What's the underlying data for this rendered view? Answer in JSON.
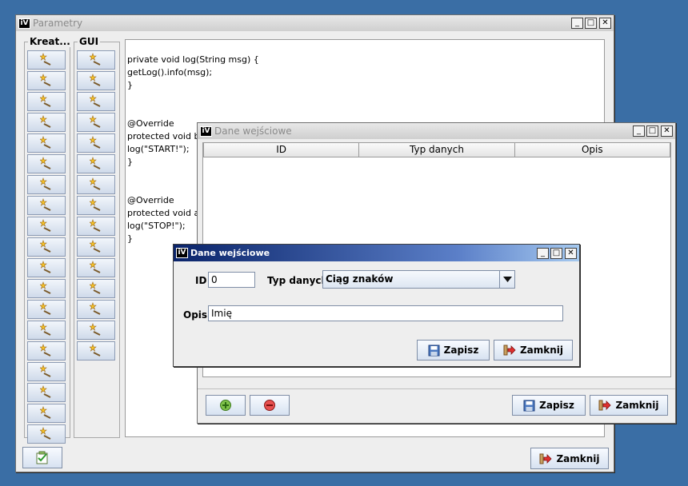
{
  "main_window": {
    "icon_text": "iV",
    "title": "Parametry",
    "controls": {
      "minimize": "_",
      "maximize": "□",
      "close": "✕"
    },
    "col_kreator_label": "Kreat...",
    "col_gui_label": "GUI",
    "code_lines": [
      "private void log(String msg) {",
      "getLog().info(msg);",
      "}",
      "",
      "",
      "@Override",
      "protected void be",
      "log(\"START!\");",
      "}",
      "",
      "",
      "@Override",
      "protected void af",
      "log(\"STOP!\");",
      "}"
    ],
    "zamknij_label": "Zamknij"
  },
  "table_window": {
    "icon_text": "iV",
    "title": "Dane wejściowe",
    "columns": [
      "ID",
      "Typ danych",
      "Opis"
    ],
    "zapisz_label": "Zapisz",
    "zamknij_label": "Zamknij"
  },
  "edit_dialog": {
    "icon_text": "iV",
    "title": "Dane wejściowe",
    "id_label": "ID",
    "id_value": "0",
    "typ_label": "Typ danych",
    "typ_value": "Ciąg znaków",
    "opis_label": "Opis",
    "opis_value": "Imię",
    "zapisz_label": "Zapisz",
    "zamknij_label": "Zamknij"
  },
  "colors": {
    "desktop": "#3a6ea5",
    "active_title": "#0a246a"
  },
  "icons": [
    "wand-icon",
    "add-icon",
    "remove-icon",
    "save-icon",
    "exit-icon",
    "checklist-icon",
    "dropdown-arrow-icon"
  ]
}
